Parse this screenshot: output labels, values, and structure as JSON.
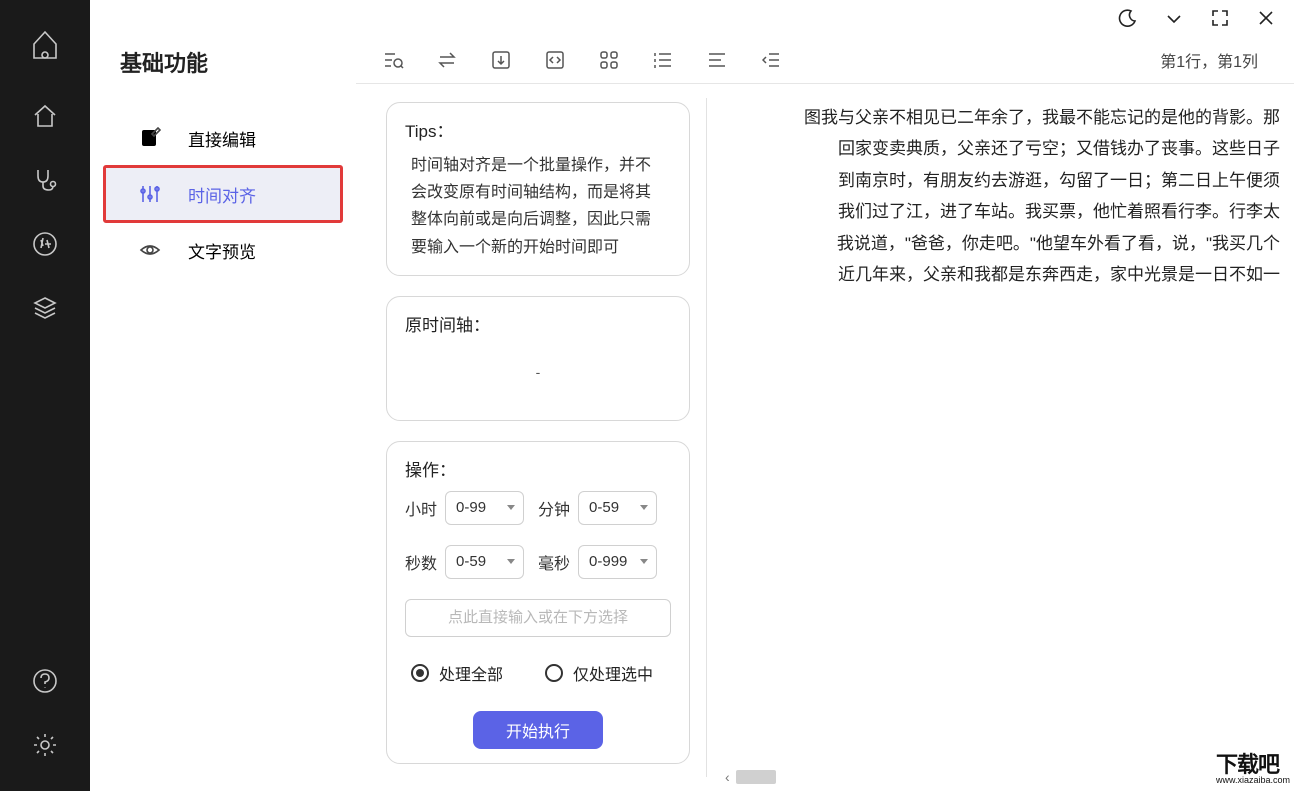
{
  "sidebar": {
    "title": "基础功能",
    "items": [
      {
        "label": "直接编辑"
      },
      {
        "label": "时间对齐"
      },
      {
        "label": "文字预览"
      }
    ]
  },
  "cursor_position": "第1行，第1列",
  "tips": {
    "title": "Tips：",
    "body": "时间轴对齐是一个批量操作，并不会改变原有时间轴结构，而是将其整体向前或是向后调整，因此只需要输入一个新的开始时间即可"
  },
  "original_timeline": {
    "title": "原时间轴：",
    "empty": "-"
  },
  "operation": {
    "title": "操作：",
    "hour_label": "小时",
    "hour_placeholder": "0-99",
    "minute_label": "分钟",
    "minute_placeholder": "0-59",
    "second_label": "秒数",
    "second_placeholder": "0-59",
    "ms_label": "毫秒",
    "ms_placeholder": "0-999",
    "direct_placeholder": "点此直接输入或在下方选择",
    "radio_all": "处理全部",
    "radio_selected": "仅处理选中",
    "exec_button": "开始执行"
  },
  "preview_text": "图我与父亲不相见已二年余了，我最不能忘记的是他的背影。那\n回家变卖典质，父亲还了亏空；又借钱办了丧事。这些日子\n到南京时，有朋友约去游逛，勾留了一日；第二日上午便须\n我们过了江，进了车站。我买票，他忙着照看行李。行李太\n我说道，\"爸爸，你走吧。\"他望车外看了看，说，\"我买几个\n近几年来，父亲和我都是东奔西走，家中光景是一日不如一",
  "watermark": {
    "main": "下载吧",
    "sub": "www.xiazaiba.com"
  }
}
